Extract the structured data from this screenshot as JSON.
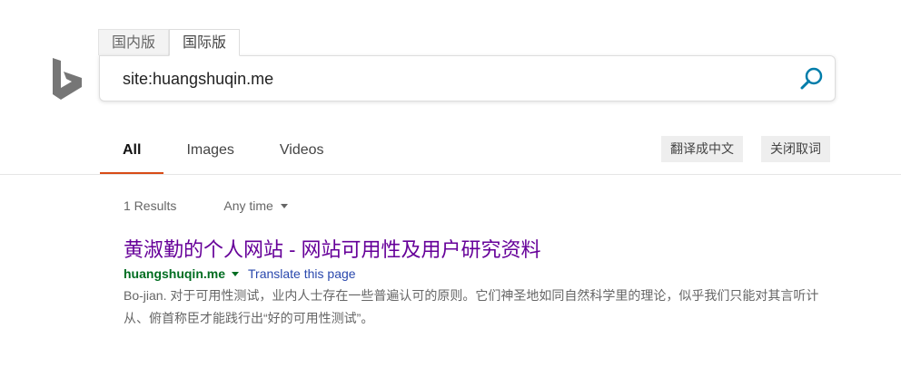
{
  "scope_tabs": [
    "国内版",
    "国际版"
  ],
  "search": {
    "query": "site:huangshuqin.me"
  },
  "nav": {
    "items": [
      "All",
      "Images",
      "Videos"
    ]
  },
  "tools": {
    "translate_label": "翻译成中文",
    "close_dict_label": "关闭取词"
  },
  "results_meta": {
    "count": "1 Results",
    "time_filter": "Any time"
  },
  "result": {
    "title": "黄淑勤的个人网站 - 网站可用性及用户研究资料",
    "url": "huangshuqin.me",
    "translate": "Translate this page",
    "snippet": "Bo-jian. 对于可用性测试，业内人士存在一些普遍认可的原则。它们神圣地如同自然科学里的理论，似乎我们只能对其言听计从、俯首称臣才能践行出“好的可用性测试”。"
  },
  "colors": {
    "accent": "#d84b16",
    "visited_title": "#660099",
    "url_green": "#006d21",
    "search_icon": "#007daa",
    "logo": "#767676"
  },
  "icons": {
    "logo": "bing-logo-icon",
    "search": "search-icon"
  }
}
